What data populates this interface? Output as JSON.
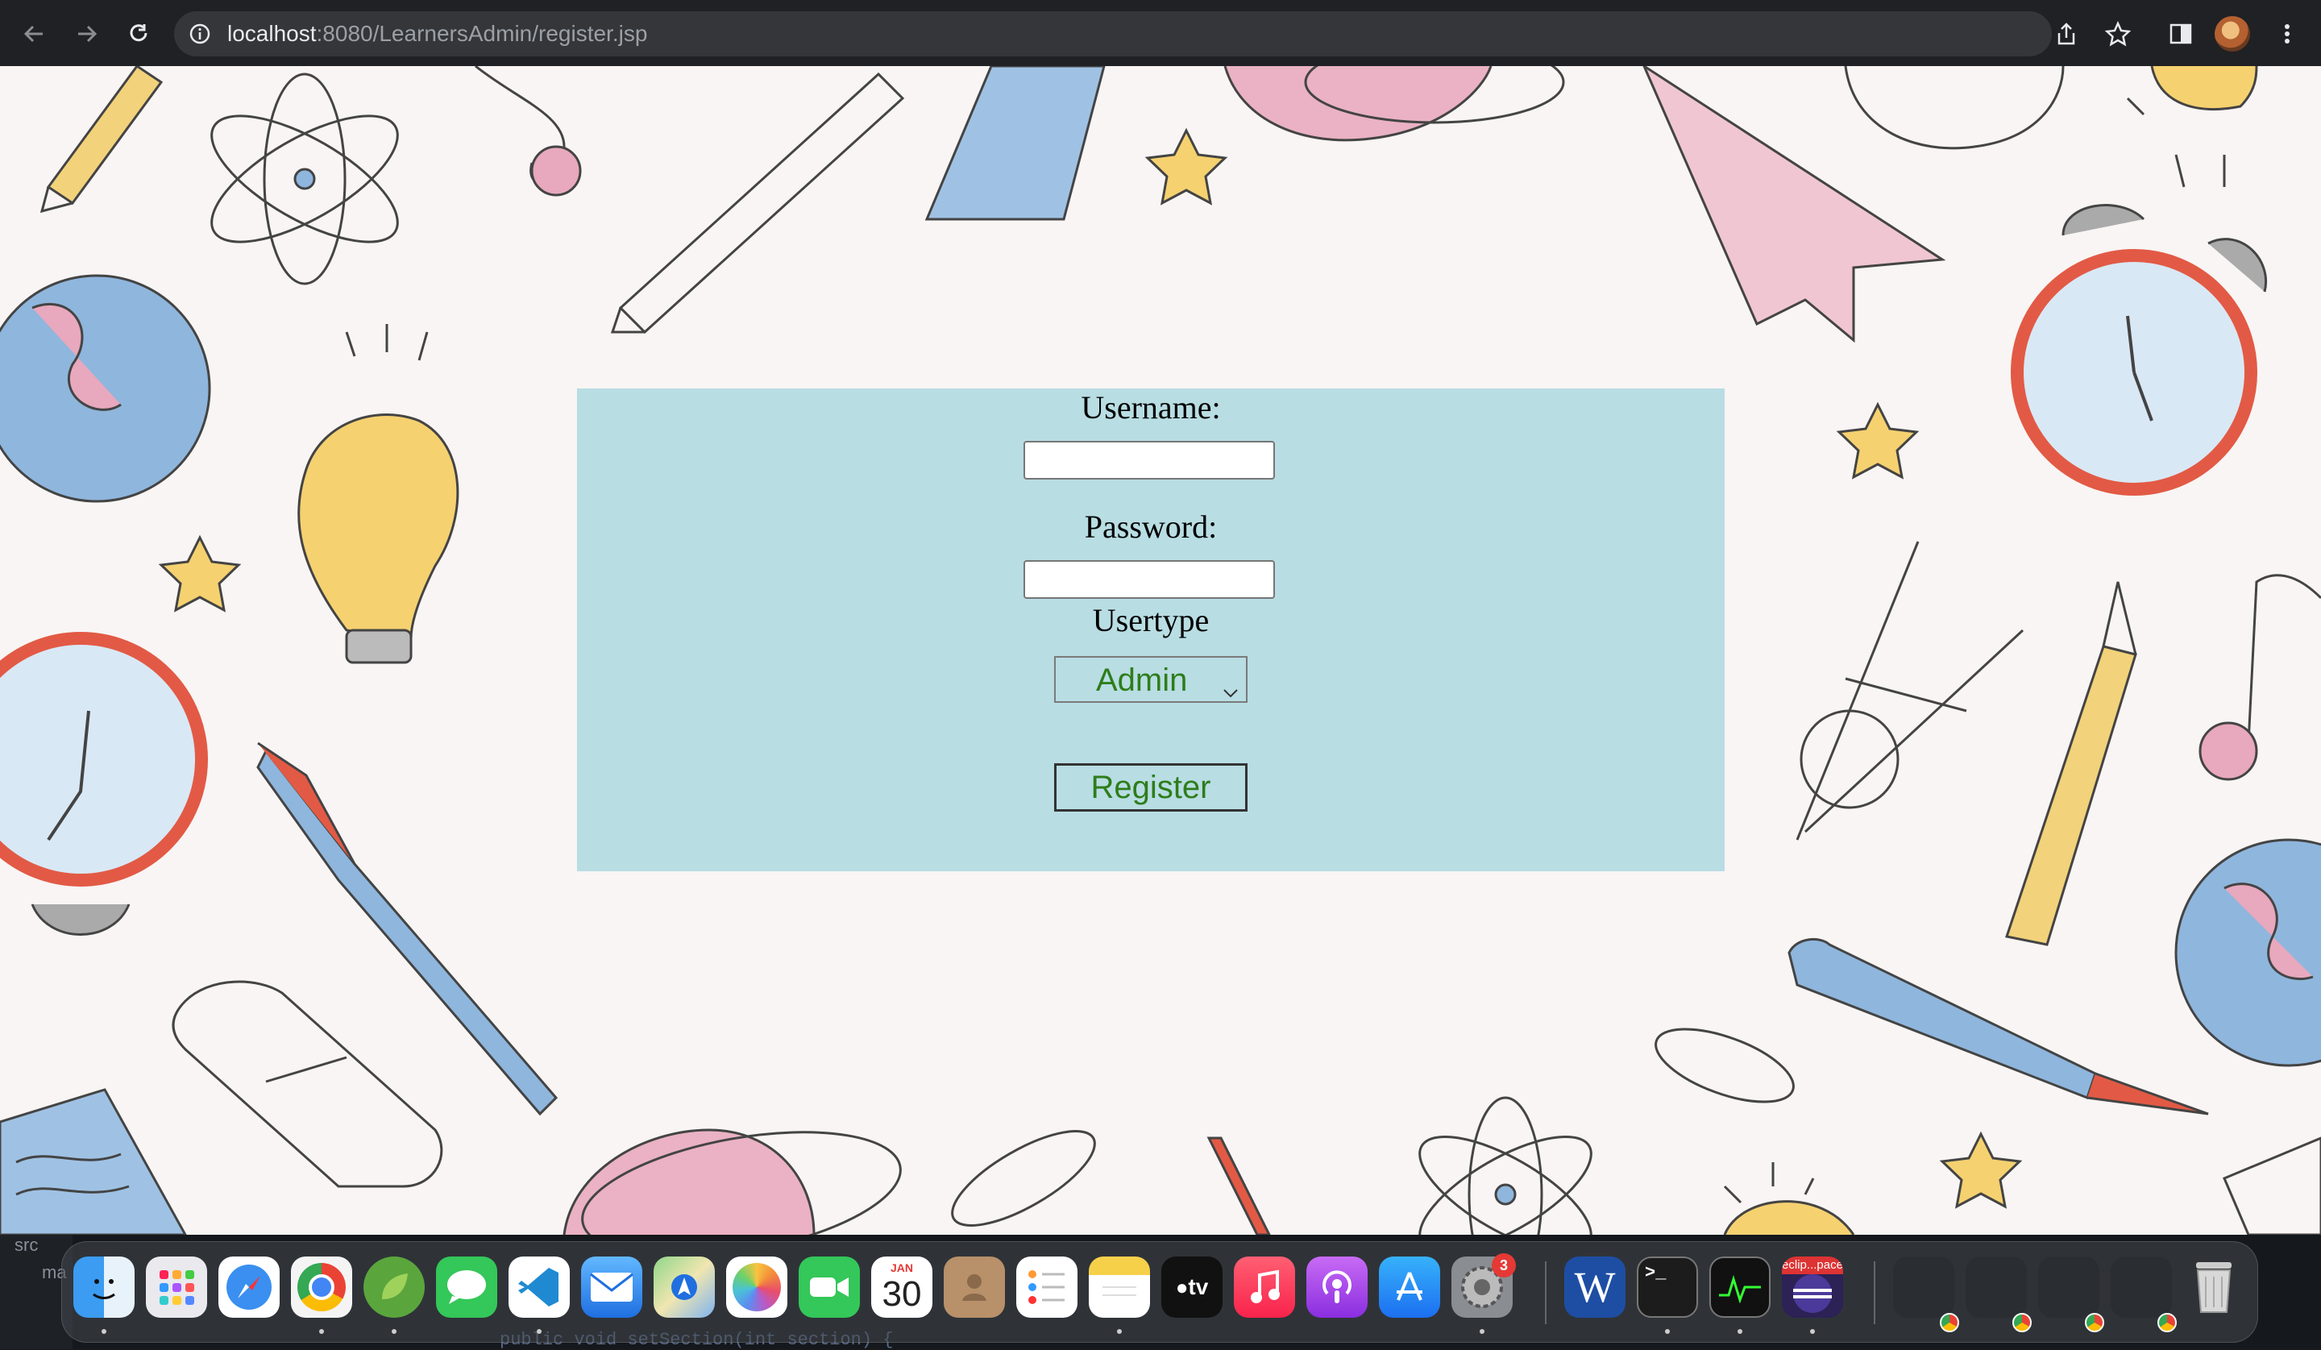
{
  "browser": {
    "url_host": "localhost",
    "url_rest": ":8080/LearnersAdmin/register.jsp",
    "icons": [
      "back-arrow-icon",
      "forward-arrow-icon",
      "reload-icon",
      "info-icon",
      "share-icon",
      "star-icon",
      "sidebar-icon",
      "profile-avatar",
      "more-vert-icon"
    ]
  },
  "form": {
    "username_label": "Username:",
    "username_value": "",
    "password_label": "Password:",
    "password_value": "",
    "usertype_label": "Usertype",
    "usertype_selected": "Admin",
    "register_label": "Register",
    "panel_color": "#b8dde3",
    "accent_text_color": "#2e7d1a"
  },
  "ide": {
    "sidebar_text_1": "src",
    "sidebar_text_2": "ma",
    "code_line": "public void setSection(int section) {"
  },
  "dock": {
    "calendar_month": "JAN",
    "calendar_day": "30",
    "settings_badge": "3",
    "appletv_label": "tv",
    "word_label": "W",
    "terminal_label": ">_",
    "eclipse_label": "eclip...pace",
    "apps": [
      "Finder",
      "Launchpad",
      "Safari",
      "Chrome",
      "Spring Tools",
      "Messages",
      "VS Code",
      "Mail",
      "Maps",
      "Photos",
      "FaceTime",
      "Calendar",
      "Contacts",
      "Reminders",
      "Notes",
      "Apple TV",
      "Music",
      "Podcasts",
      "App Store",
      "System Settings",
      "Word",
      "Terminal",
      "Activity Monitor",
      "Eclipse",
      "Trash"
    ]
  }
}
